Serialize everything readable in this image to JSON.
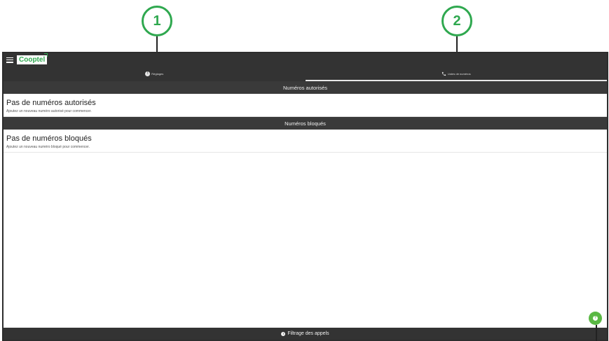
{
  "callouts": {
    "one": "1",
    "two": "2"
  },
  "app": {
    "logo_text": "Cooptel"
  },
  "tabs": [
    {
      "label": "Réglages",
      "icon": "info-icon"
    },
    {
      "label": "Listes de numéros",
      "icon": "phone-icon",
      "active": true
    }
  ],
  "sections": {
    "authorized": {
      "header": "Numéros autorisés",
      "empty_title": "Pas de numéros autorisés",
      "empty_subtitle": "Ajoutez un nouveau numéro autorisé pour commencer."
    },
    "blocked": {
      "header": "Numéros bloqués",
      "empty_title": "Pas de numéros bloqués",
      "empty_subtitle": "Ajoutez un nouveau numéro bloqué pour commencer."
    }
  },
  "bottom_bar": {
    "label": "Filtrage des appels",
    "icon": "info-icon"
  },
  "colors": {
    "accent": "#2fa84f",
    "dark_bar": "#333333",
    "fab": "#5ab844"
  }
}
